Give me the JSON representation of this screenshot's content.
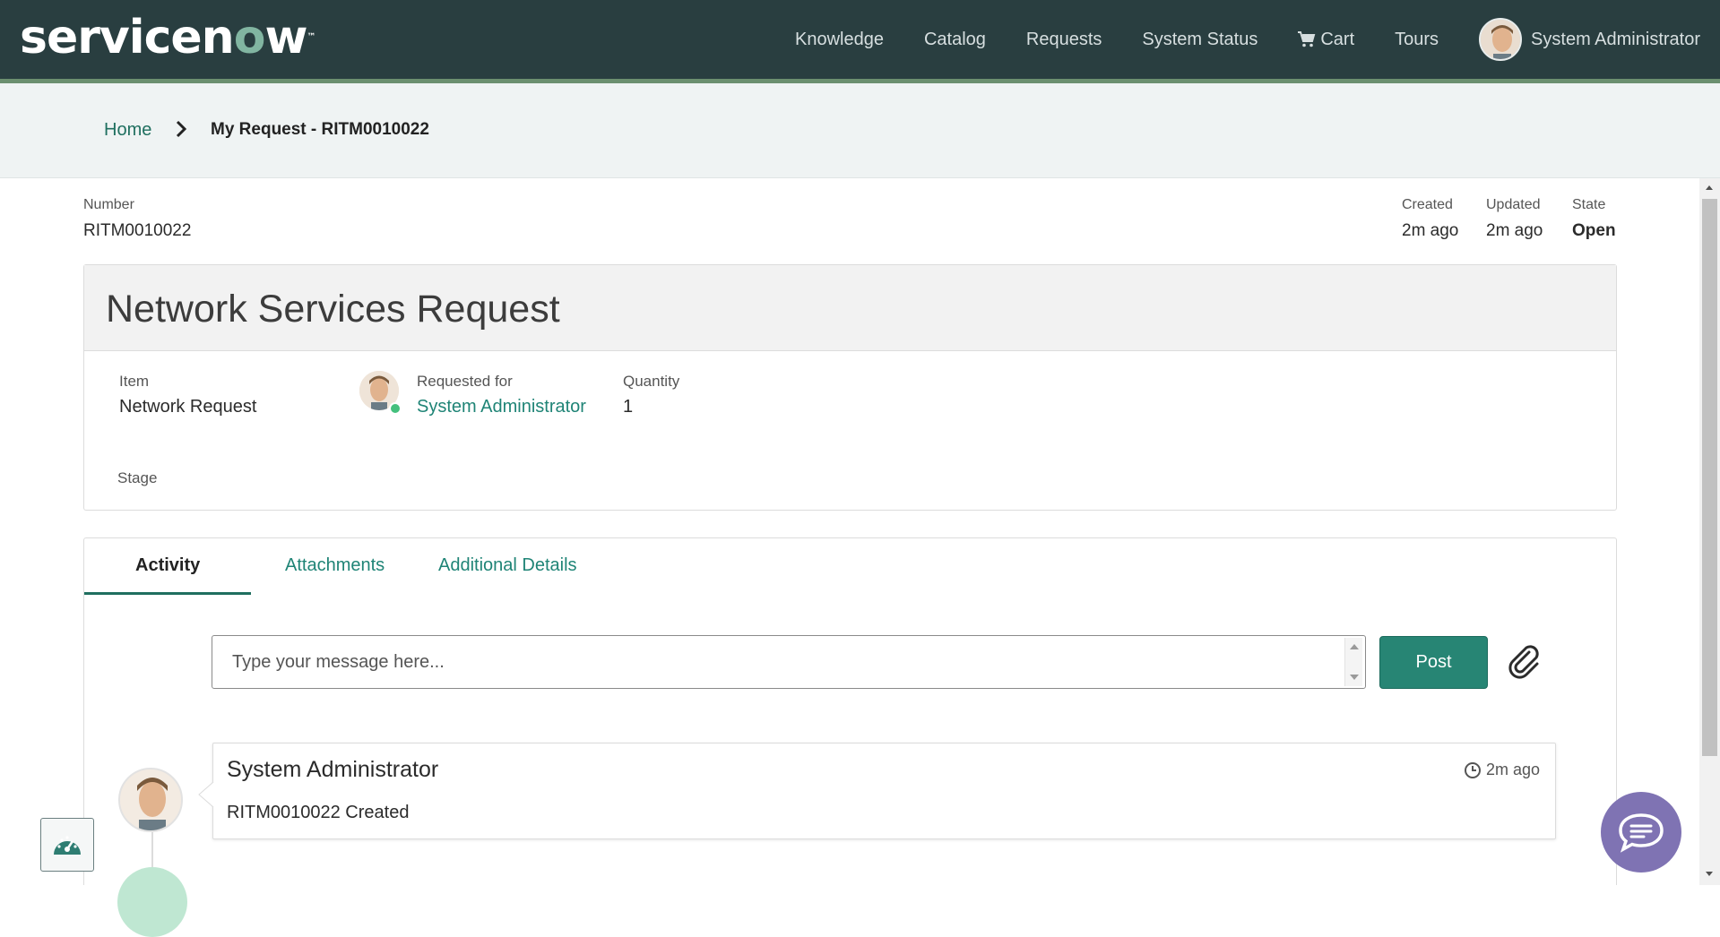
{
  "header": {
    "logo_main": "servicen",
    "logo_o": "o",
    "logo_end": "w",
    "logo_tm": "™",
    "nav": [
      "Knowledge",
      "Catalog",
      "Requests",
      "System Status",
      "Cart",
      "Tours"
    ],
    "user_name": "System Administrator"
  },
  "breadcrumb": {
    "home": "Home",
    "current": "My Request - RITM0010022"
  },
  "meta": {
    "number_label": "Number",
    "number_value": "RITM0010022",
    "created_label": "Created",
    "created_value": "2m ago",
    "updated_label": "Updated",
    "updated_value": "2m ago",
    "state_label": "State",
    "state_value": "Open"
  },
  "request": {
    "title": "Network Services Request",
    "item_label": "Item",
    "item_value": "Network Request",
    "requested_for_label": "Requested for",
    "requested_for_value": "System Administrator",
    "quantity_label": "Quantity",
    "quantity_value": "1",
    "stage_label": "Stage"
  },
  "tabs": [
    "Activity",
    "Attachments",
    "Additional Details"
  ],
  "composer": {
    "placeholder": "Type your message here...",
    "post_label": "Post"
  },
  "activity": [
    {
      "author": "System Administrator",
      "time": "2m ago",
      "message": "RITM0010022 Created"
    }
  ],
  "colors": {
    "header_bg": "#293e40",
    "accent": "#278574",
    "link": "#1f8476",
    "presence": "#44c07d",
    "chat": "#7f73b3"
  }
}
